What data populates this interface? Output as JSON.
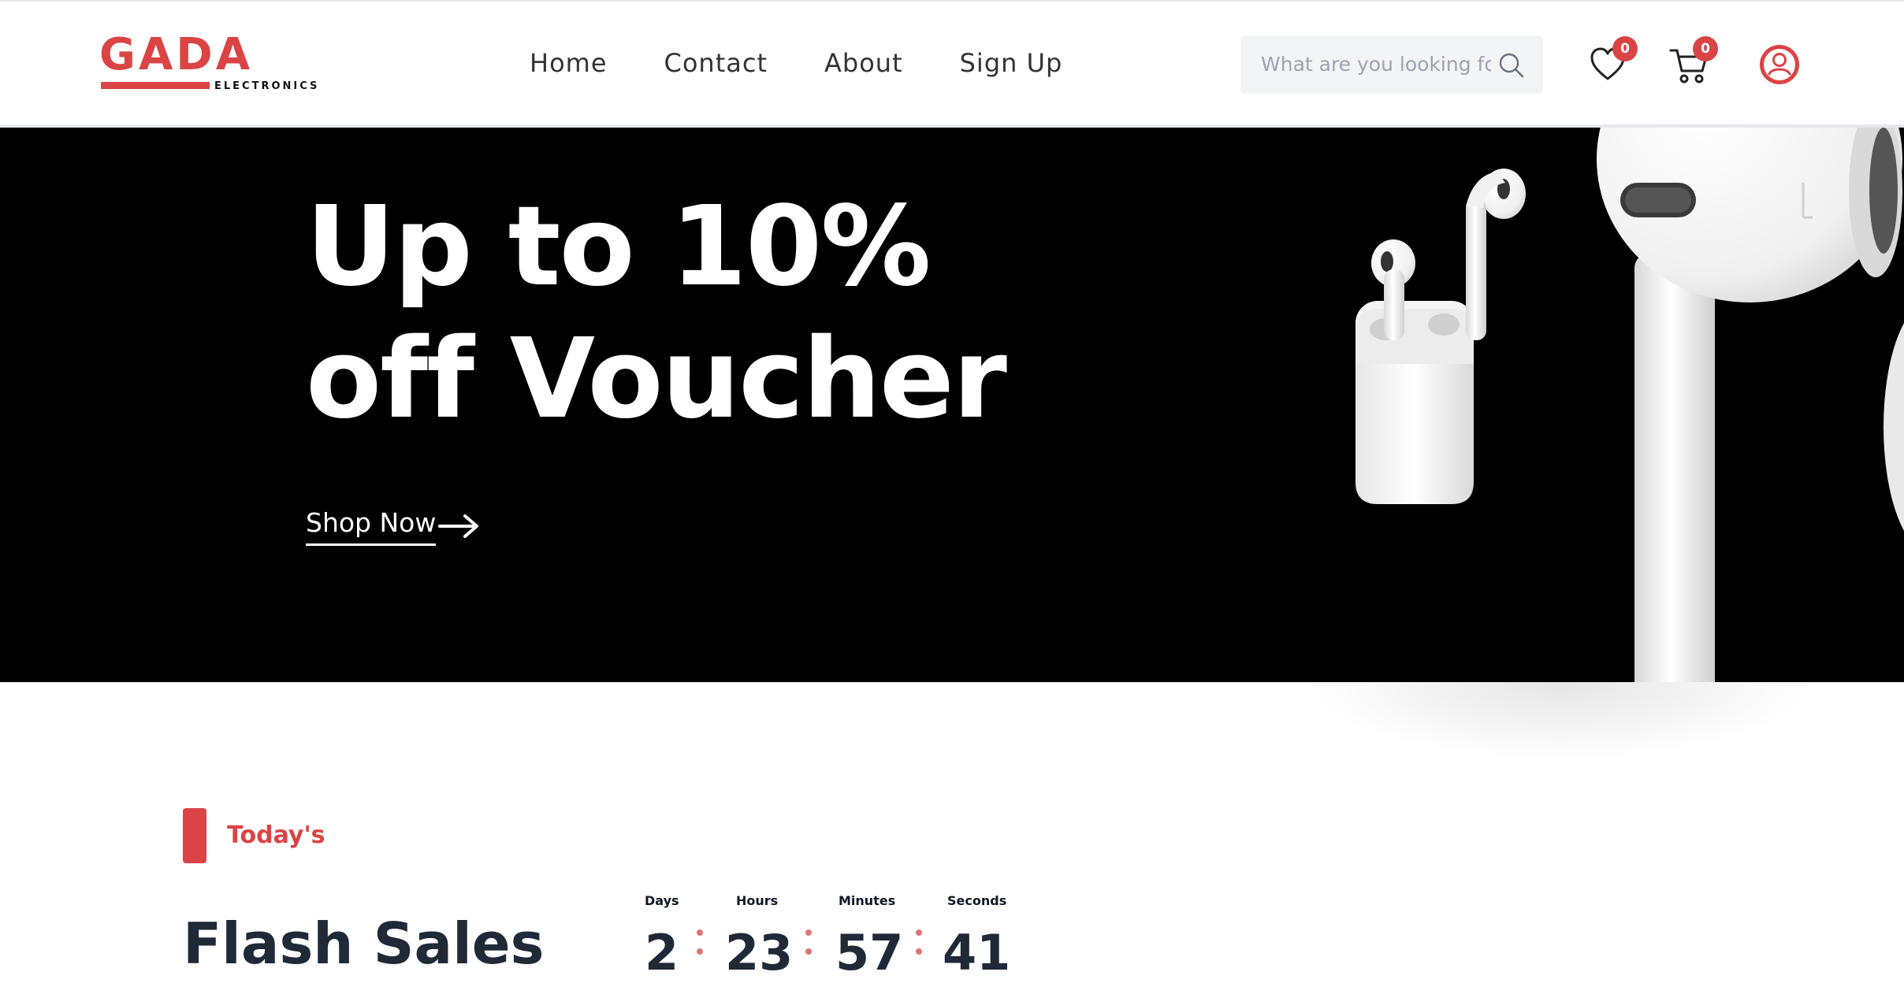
{
  "brand": {
    "name": "GADA",
    "tagline": "ELECTRONICS",
    "color": "#db4444"
  },
  "nav": {
    "items": [
      "Home",
      "Contact",
      "About",
      "Sign Up"
    ]
  },
  "search": {
    "placeholder": "What are you looking for",
    "icon": "search-icon"
  },
  "header_icons": {
    "wishlist": {
      "icon": "heart-icon",
      "count": "0"
    },
    "cart": {
      "icon": "cart-icon",
      "count": "0"
    },
    "account": {
      "icon": "user-icon"
    }
  },
  "hero": {
    "title_line1": "Up to 10%",
    "title_line2": "off Voucher",
    "cta_label": "Shop Now",
    "cta_icon": "arrow-right-icon",
    "image": "airpods-and-earbud-image",
    "background": "#000000"
  },
  "section": {
    "tag": "Today's",
    "title": "Flash Sales",
    "countdown": {
      "labels": [
        "Days",
        "Hours",
        "Minutes",
        "Seconds"
      ],
      "values": [
        "2",
        "23",
        "57",
        "41"
      ]
    }
  }
}
